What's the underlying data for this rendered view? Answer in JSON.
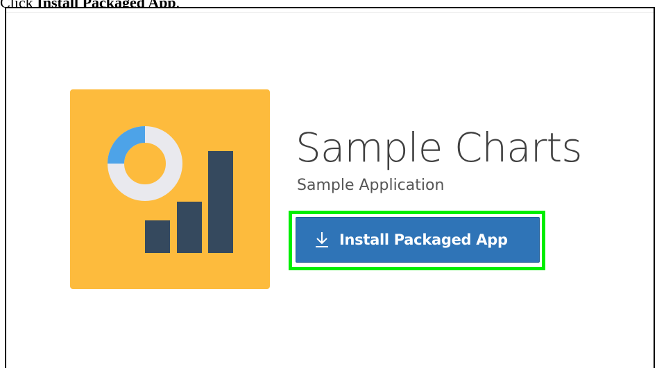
{
  "instruction": {
    "prefix": "Click ",
    "target": "Install Packaged App",
    "suffix": "."
  },
  "app": {
    "title": "Sample Charts",
    "subtitle": "Sample Application",
    "icon": "chart-icon",
    "tile_color": "#fdbb3d"
  },
  "install_button": {
    "label": "Install Packaged App",
    "icon": "download-icon",
    "color": "#2f74b7"
  },
  "highlight_color": "#00ee00"
}
